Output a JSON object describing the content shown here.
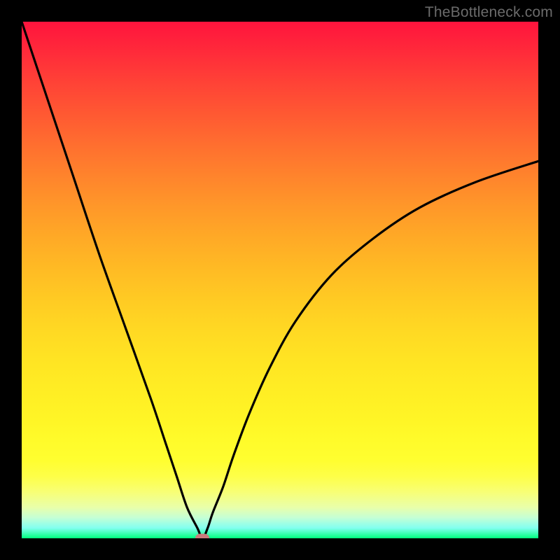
{
  "watermark": "TheBottleneck.com",
  "chart_data": {
    "type": "line",
    "title": "",
    "xlabel": "",
    "ylabel": "",
    "xlim": [
      0,
      100
    ],
    "ylim": [
      0,
      100
    ],
    "grid": false,
    "legend": false,
    "series": [
      {
        "name": "bottleneck-curve",
        "x": [
          0,
          5,
          10,
          15,
          20,
          25,
          28,
          30,
          32,
          34,
          35,
          36,
          37,
          39,
          41,
          44,
          48,
          53,
          60,
          68,
          77,
          88,
          100
        ],
        "values": [
          100,
          85,
          70,
          55,
          41,
          27,
          18,
          12,
          6,
          2,
          0,
          2,
          5,
          10,
          16,
          24,
          33,
          42,
          51,
          58,
          64,
          69,
          73
        ]
      }
    ],
    "marker": {
      "x": 35,
      "y": 0,
      "color": "#cb7b7c"
    },
    "background": "red-yellow-green vertical gradient"
  }
}
